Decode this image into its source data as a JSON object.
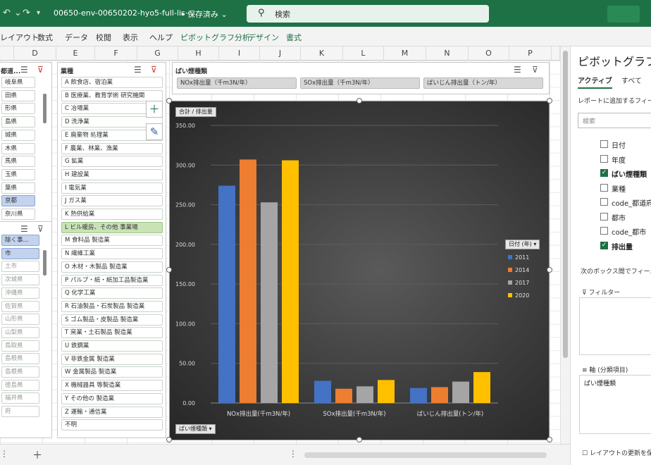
{
  "titlebar": {
    "filename": "00650-env-00650202-hyo5-full-lis···",
    "save_status": "• 保存済み",
    "search_placeholder": "検索"
  },
  "ribbon": {
    "tabs": [
      "レイアウト",
      "数式",
      "データ",
      "校閲",
      "表示",
      "ヘルプ",
      "ピボットグラフ分析",
      "デザイン",
      "書式"
    ]
  },
  "columns": [
    "D",
    "E",
    "F",
    "G",
    "H",
    "I",
    "J",
    "K",
    "L",
    "M",
    "N",
    "O",
    "P"
  ],
  "slicer_left_top": {
    "title": "都道...",
    "items": [
      "岐阜県",
      "田県",
      "形県",
      "島県",
      "城県",
      "木県",
      "馬県",
      "玉県",
      "葉県",
      "京都",
      "奈川県"
    ]
  },
  "slicer_left_bottom": {
    "items": [
      "除く事...",
      "市",
      "土市",
      "次城県",
      "沖縄県",
      "佐賀県",
      "山形県",
      "山梨県",
      "鳥取県",
      "島根県",
      "島根県",
      "徳島県",
      "福井県",
      "府"
    ]
  },
  "slicer_industry": {
    "title": "業種",
    "items": [
      "A 飲食店、宿泊業",
      "B 医療業、教育学術 研究機関",
      "C 冶場業",
      "D 洗浄業",
      "E 廃棄物 処理業",
      "F 農業、林業、漁業",
      "G 鉱業",
      "H 建設業",
      "I 電気業",
      "J ガス業",
      "K 熱供給業",
      "L ビル暖房、その他 事業場",
      "M 食料品 製造業",
      "N 繊維工業",
      "O 木材・木製品 製造業",
      "P パルプ・紙・紙加工品製造業",
      "Q 化学工業",
      "R 石油製品・石炭製品 製造業",
      "S ゴム製品・皮製品 製造業",
      "T 窯業・土石製品 製造業",
      "U 鉄鋼業",
      "V 非鉄金属 製造業",
      "W 金属製品 製造業",
      "X 機械器具 等製造業",
      "Y その他の 製造業",
      "Z 運輸・通信業",
      "不明"
    ]
  },
  "slicer_type": {
    "title": "ばい煙種類",
    "items": [
      "NOx排出量（千m3N/年）",
      "SOx排出量（千m3N/年）",
      "ばいじん排出量（トン/年）"
    ]
  },
  "chart_data": {
    "type": "bar",
    "title": "",
    "value_label": "合計 / 排出量",
    "axis_field_button": "ばい煙種類",
    "legend_title": "日付 (年)",
    "legend_position": "right",
    "categories": [
      "NOx排出量(千m3N/年)",
      "SOx排出量(千m3N/年)",
      "ばいじん排出量(トン/年)"
    ],
    "series": [
      {
        "name": "2011",
        "color": "#4472c4",
        "values": [
          274,
          28,
          19
        ]
      },
      {
        "name": "2014",
        "color": "#ed7d31",
        "values": [
          307,
          18,
          20
        ]
      },
      {
        "name": "2017",
        "color": "#a5a5a5",
        "values": [
          253,
          21,
          27
        ]
      },
      {
        "name": "2020",
        "color": "#ffc000",
        "values": [
          306,
          29,
          39
        ]
      }
    ],
    "ylim": [
      0,
      350
    ],
    "yticks": [
      "0.00",
      "50.00",
      "100.00",
      "150.00",
      "200.00",
      "250.00",
      "300.00",
      "350.00"
    ],
    "grid": true
  },
  "pane": {
    "title": "ピボットグラフの",
    "tabs": [
      "アクティブ",
      "すべて"
    ],
    "hint": "レポートに追加するフィール",
    "search_placeholder": "検索",
    "fields": [
      {
        "label": "日付",
        "checked": false
      },
      {
        "label": "年度",
        "checked": false
      },
      {
        "label": "ばい煙種類",
        "checked": true
      },
      {
        "label": "業種",
        "checked": false
      },
      {
        "label": "code_都道府",
        "checked": false
      },
      {
        "label": "都市",
        "checked": false
      },
      {
        "label": "code_都市",
        "checked": false
      },
      {
        "label": "排出量",
        "checked": true
      }
    ],
    "drag_hint": "次のボックス間でフィールド",
    "filter_label": "フィルター",
    "axis_label": "軸 (分類項目)",
    "axis_item": "ばい煙種類",
    "defer_label": "レイアウトの更新を保"
  }
}
